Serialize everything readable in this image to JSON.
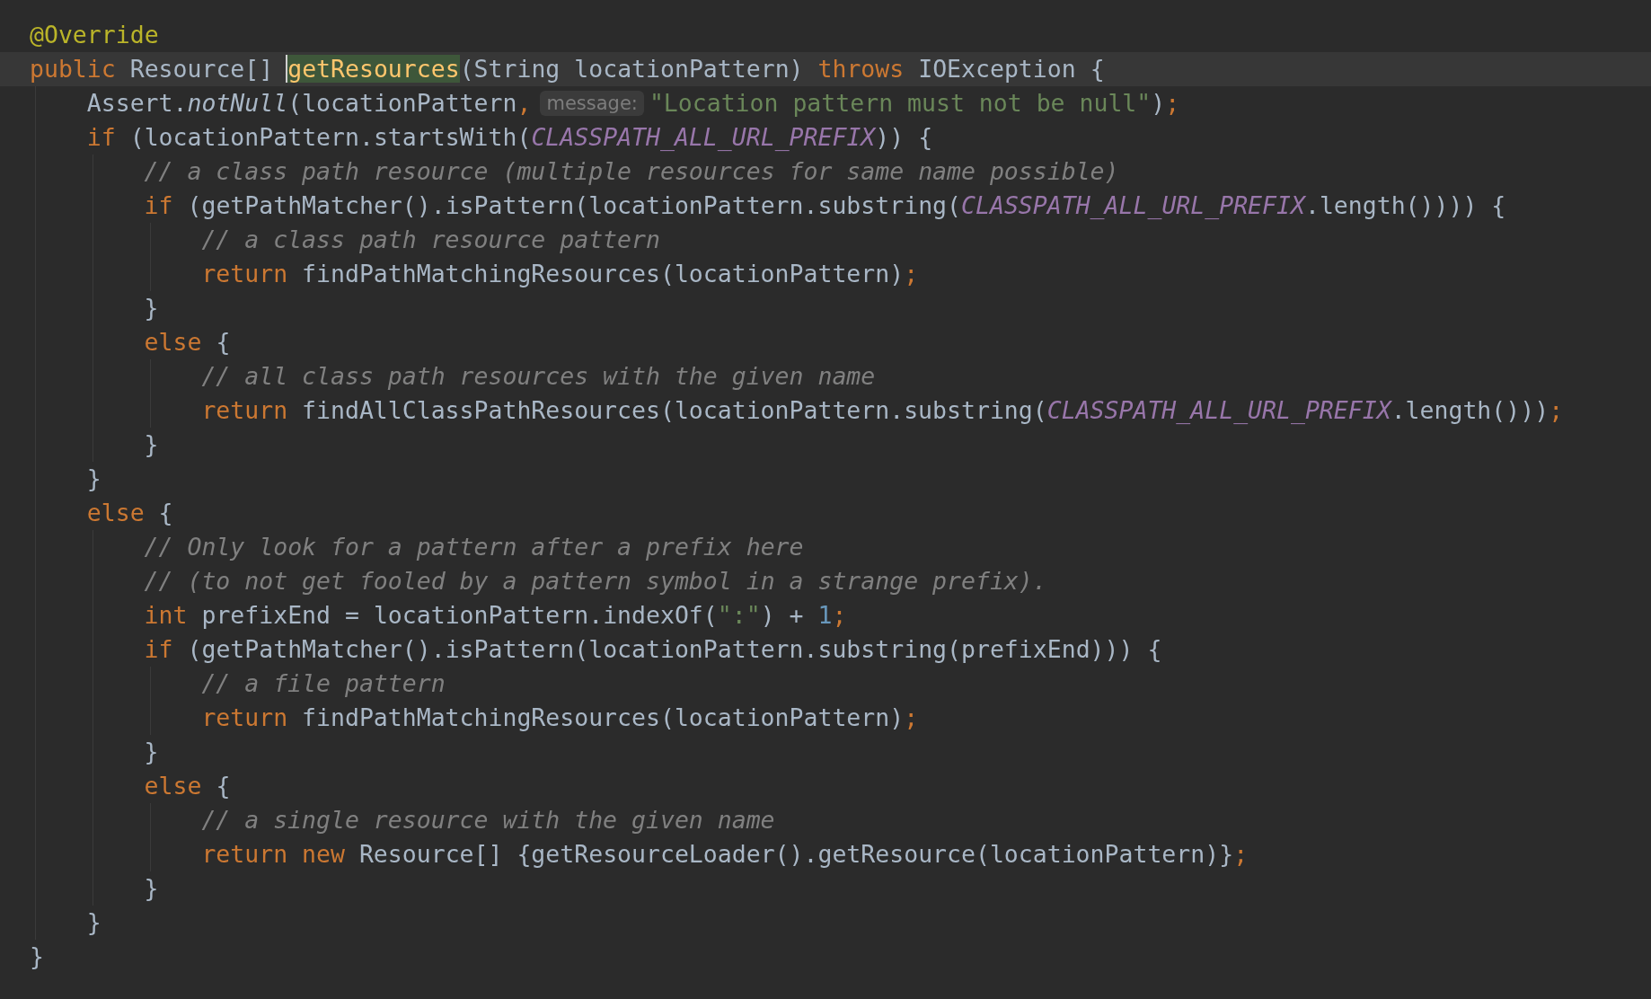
{
  "lines": [
    {
      "current": false,
      "tokens": [
        {
          "text": "@Override",
          "kind": "annotation"
        }
      ]
    },
    {
      "current": true,
      "tokens": [
        {
          "text": "public",
          "kind": "keyword"
        },
        {
          "text": " Resource[] ",
          "kind": "plain"
        },
        {
          "text": "getResources",
          "kind": "declaration",
          "highlighted": true,
          "caret_before": true
        },
        {
          "text": "(String locationPattern) ",
          "kind": "plain"
        },
        {
          "text": "throws",
          "kind": "keyword"
        },
        {
          "text": " IOException {",
          "kind": "plain"
        }
      ],
      "children": [
        {
          "current": false,
          "tokens": [
            {
              "text": "Assert.",
              "kind": "plain"
            },
            {
              "text": "notNull",
              "kind": "italic"
            },
            {
              "text": "(locationPattern",
              "kind": "plain"
            },
            {
              "text": ",",
              "kind": "keyword"
            },
            {
              "text": "message:",
              "kind": "hint"
            },
            {
              "text": "\"Location pattern must not be null\"",
              "kind": "string"
            },
            {
              "text": ")",
              "kind": "plain"
            },
            {
              "text": ";",
              "kind": "keyword"
            }
          ]
        },
        {
          "current": false,
          "tokens": [
            {
              "text": "if",
              "kind": "keyword"
            },
            {
              "text": " (locationPattern.startsWith(",
              "kind": "plain"
            },
            {
              "text": "CLASSPATH_ALL_URL_PREFIX",
              "kind": "constant"
            },
            {
              "text": ")) {",
              "kind": "plain"
            }
          ],
          "children": [
            {
              "current": false,
              "tokens": [
                {
                  "text": "// a class path resource (multiple resources for same name possible)",
                  "kind": "comment"
                }
              ]
            },
            {
              "current": false,
              "tokens": [
                {
                  "text": "if",
                  "kind": "keyword"
                },
                {
                  "text": " (getPathMatcher().isPattern(locationPattern.substring(",
                  "kind": "plain"
                },
                {
                  "text": "CLASSPATH_ALL_URL_PREFIX",
                  "kind": "constant"
                },
                {
                  "text": ".length()))) {",
                  "kind": "plain"
                }
              ],
              "children": [
                {
                  "current": false,
                  "tokens": [
                    {
                      "text": "// a class path resource pattern",
                      "kind": "comment"
                    }
                  ]
                },
                {
                  "current": false,
                  "tokens": [
                    {
                      "text": "return",
                      "kind": "keyword"
                    },
                    {
                      "text": " findPathMatchingResources(locationPattern)",
                      "kind": "plain"
                    },
                    {
                      "text": ";",
                      "kind": "keyword"
                    }
                  ]
                }
              ]
            },
            {
              "current": false,
              "tokens": [
                {
                  "text": "}",
                  "kind": "plain"
                }
              ]
            },
            {
              "current": false,
              "tokens": [
                {
                  "text": "else",
                  "kind": "keyword"
                },
                {
                  "text": " {",
                  "kind": "plain"
                }
              ],
              "children": [
                {
                  "current": false,
                  "tokens": [
                    {
                      "text": "// all class path resources with the given name",
                      "kind": "comment"
                    }
                  ]
                },
                {
                  "current": false,
                  "tokens": [
                    {
                      "text": "return",
                      "kind": "keyword"
                    },
                    {
                      "text": " findAllClassPathResources(locationPattern.substring(",
                      "kind": "plain"
                    },
                    {
                      "text": "CLASSPATH_ALL_URL_PREFIX",
                      "kind": "constant"
                    },
                    {
                      "text": ".length()))",
                      "kind": "plain"
                    },
                    {
                      "text": ";",
                      "kind": "keyword"
                    }
                  ]
                }
              ]
            },
            {
              "current": false,
              "tokens": [
                {
                  "text": "}",
                  "kind": "plain"
                }
              ]
            }
          ]
        },
        {
          "current": false,
          "tokens": [
            {
              "text": "}",
              "kind": "plain"
            }
          ]
        },
        {
          "current": false,
          "tokens": [
            {
              "text": "else",
              "kind": "keyword"
            },
            {
              "text": " {",
              "kind": "plain"
            }
          ],
          "children": [
            {
              "current": false,
              "tokens": [
                {
                  "text": "// Only look for a pattern after a prefix here",
                  "kind": "comment"
                }
              ]
            },
            {
              "current": false,
              "tokens": [
                {
                  "text": "// (to not get fooled by a pattern symbol in a strange prefix).",
                  "kind": "comment"
                }
              ]
            },
            {
              "current": false,
              "tokens": [
                {
                  "text": "int",
                  "kind": "keyword"
                },
                {
                  "text": " prefixEnd = locationPattern.indexOf(",
                  "kind": "plain"
                },
                {
                  "text": "\":\"",
                  "kind": "string"
                },
                {
                  "text": ") + ",
                  "kind": "plain"
                },
                {
                  "text": "1",
                  "kind": "number"
                },
                {
                  "text": ";",
                  "kind": "keyword"
                }
              ]
            },
            {
              "current": false,
              "tokens": [
                {
                  "text": "if",
                  "kind": "keyword"
                },
                {
                  "text": " (getPathMatcher().isPattern(locationPattern.substring(prefixEnd))) {",
                  "kind": "plain"
                }
              ],
              "children": [
                {
                  "current": false,
                  "tokens": [
                    {
                      "text": "// a file pattern",
                      "kind": "comment"
                    }
                  ]
                },
                {
                  "current": false,
                  "tokens": [
                    {
                      "text": "return",
                      "kind": "keyword"
                    },
                    {
                      "text": " findPathMatchingResources(locationPattern)",
                      "kind": "plain"
                    },
                    {
                      "text": ";",
                      "kind": "keyword"
                    }
                  ]
                }
              ]
            },
            {
              "current": false,
              "tokens": [
                {
                  "text": "}",
                  "kind": "plain"
                }
              ]
            },
            {
              "current": false,
              "tokens": [
                {
                  "text": "else",
                  "kind": "keyword"
                },
                {
                  "text": " {",
                  "kind": "plain"
                }
              ],
              "children": [
                {
                  "current": false,
                  "tokens": [
                    {
                      "text": "// a single resource with the given name",
                      "kind": "comment"
                    }
                  ]
                },
                {
                  "current": false,
                  "tokens": [
                    {
                      "text": "return",
                      "kind": "keyword"
                    },
                    {
                      "text": " new",
                      "kind": "keyword"
                    },
                    {
                      "text": " Resource[] {getResourceLoader().getResource(locationPattern)}",
                      "kind": "plain"
                    },
                    {
                      "text": ";",
                      "kind": "keyword"
                    }
                  ]
                }
              ]
            },
            {
              "current": false,
              "tokens": [
                {
                  "text": "}",
                  "kind": "plain"
                }
              ]
            }
          ]
        },
        {
          "current": false,
          "tokens": [
            {
              "text": "}",
              "kind": "plain"
            }
          ]
        }
      ]
    },
    {
      "current": false,
      "tokens": [
        {
          "text": "}",
          "kind": "plain"
        }
      ]
    }
  ]
}
